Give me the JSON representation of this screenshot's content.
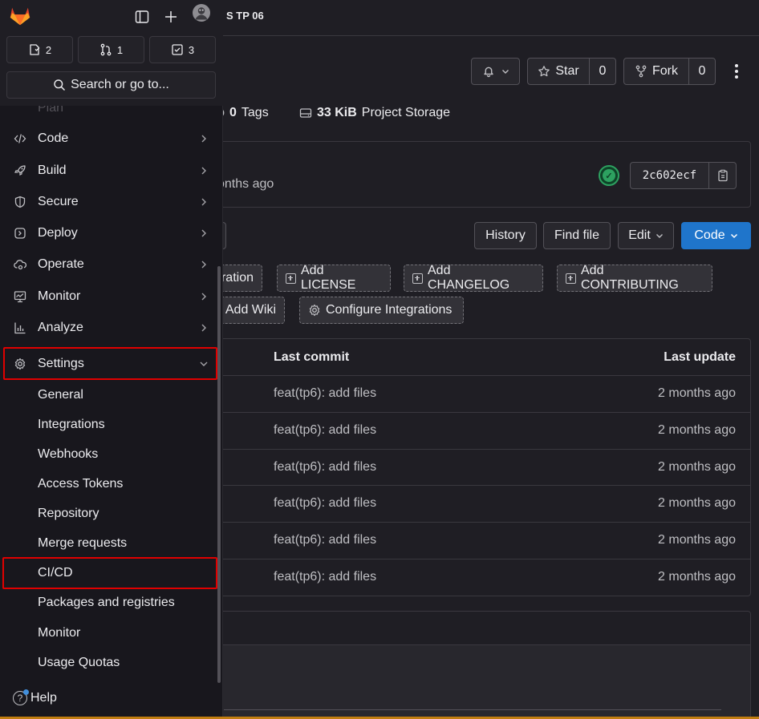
{
  "topbar": {
    "project_crumb": "S TP 06"
  },
  "actions": {
    "star_label": "Star",
    "star_count": "0",
    "fork_label": "Fork",
    "fork_count": "0"
  },
  "stats": {
    "tags_count": "0",
    "tags_label": "Tags",
    "storage_size": "33 KiB",
    "storage_label": "Project Storage"
  },
  "last_commit": {
    "time_ago": "onths ago",
    "sha": "2c602ecf"
  },
  "repo_buttons": {
    "history": "History",
    "find_file": "Find file",
    "edit": "Edit",
    "code": "Code"
  },
  "quick_add": {
    "integration_partial": "ration",
    "license": "Add LICENSE",
    "changelog": "Add CHANGELOG",
    "contributing": "Add CONTRIBUTING",
    "wiki": "Add Wiki",
    "configure": "Configure Integrations"
  },
  "file_table": {
    "col_last_commit": "Last commit",
    "col_last_update": "Last update",
    "rows": [
      {
        "message": "feat(tp6): add files",
        "updated": "2 months ago"
      },
      {
        "message": "feat(tp6): add files",
        "updated": "2 months ago"
      },
      {
        "message": "feat(tp6): add files",
        "updated": "2 months ago"
      },
      {
        "message": "feat(tp6): add files",
        "updated": "2 months ago"
      },
      {
        "message": "feat(tp6): add files",
        "updated": "2 months ago"
      },
      {
        "message": "feat(tp6): add files",
        "updated": "2 months ago"
      }
    ]
  },
  "sidebar": {
    "counts": {
      "issues": "2",
      "merge_requests": "1",
      "todos": "3"
    },
    "search_label": "Search or go to...",
    "plan_label": "Plan",
    "nav": {
      "code": "Code",
      "build": "Build",
      "secure": "Secure",
      "deploy": "Deploy",
      "operate": "Operate",
      "monitor": "Monitor",
      "analyze": "Analyze",
      "settings": "Settings"
    },
    "settings_sub": {
      "general": "General",
      "integrations": "Integrations",
      "webhooks": "Webhooks",
      "access_tokens": "Access Tokens",
      "repository": "Repository",
      "merge_requests": "Merge requests",
      "cicd": "CI/CD",
      "packages": "Packages and registries",
      "monitor": "Monitor",
      "usage_quotas": "Usage Quotas"
    },
    "help_label": "Help"
  },
  "colors": {
    "accent_blue": "#1f75cb",
    "highlight_red": "#e00000",
    "success_green": "#2da160"
  }
}
